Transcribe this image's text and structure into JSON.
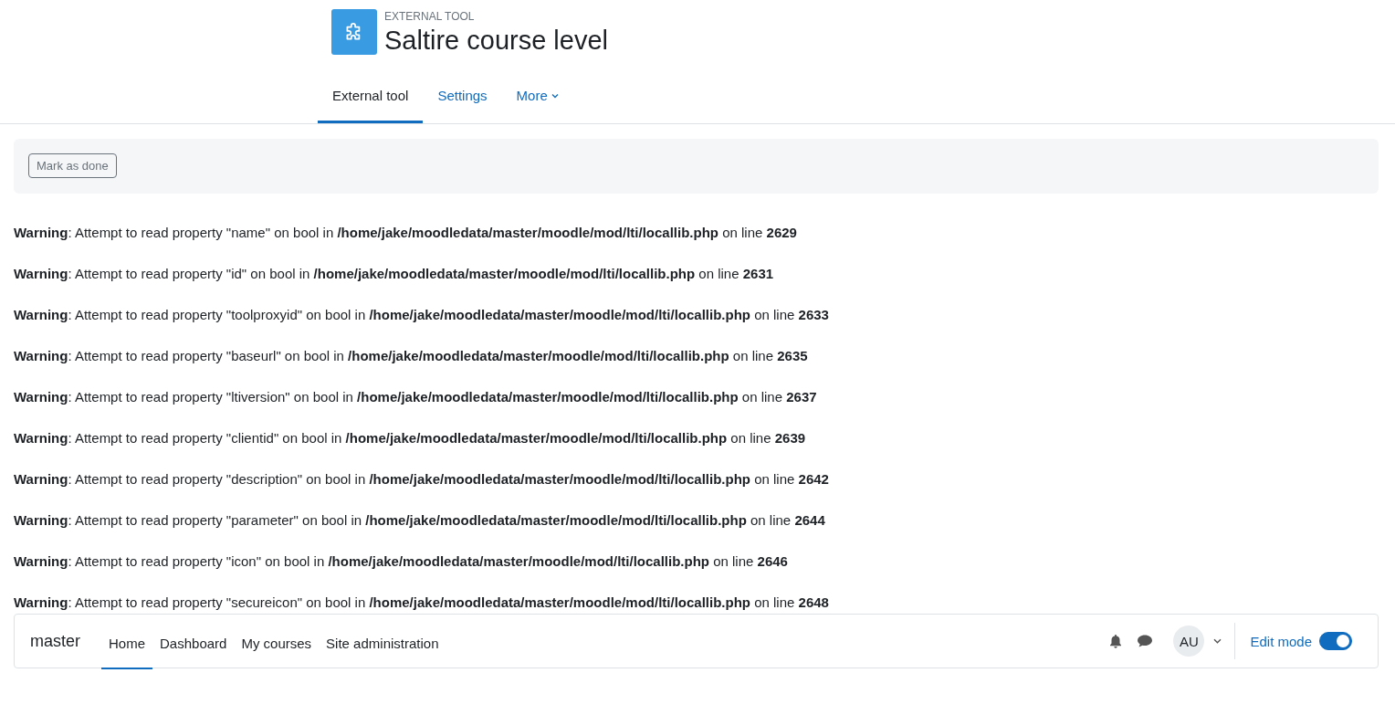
{
  "header": {
    "kind_label": "EXTERNAL TOOL",
    "title": "Saltire course level"
  },
  "tabs": [
    {
      "label": "External tool",
      "selected": true
    },
    {
      "label": "Settings",
      "selected": false
    },
    {
      "label": "More",
      "selected": false,
      "dropdown": true
    }
  ],
  "completion": {
    "button": "Mark as done"
  },
  "warnings": [
    "**Warning**: Attempt to read property \"name\" on bool in **/home/jake/moodledata/master/moodle/mod/lti/locallib.php** on line **2629**",
    "**Warning**: Attempt to read property \"id\" on bool in **/home/jake/moodledata/master/moodle/mod/lti/locallib.php** on line **2631**",
    "**Warning**: Attempt to read property \"toolproxyid\" on bool in **/home/jake/moodledata/master/moodle/mod/lti/locallib.php** on line **2633**",
    "**Warning**: Attempt to read property \"baseurl\" on bool in **/home/jake/moodledata/master/moodle/mod/lti/locallib.php** on line **2635**",
    "**Warning**: Attempt to read property \"ltiversion\" on bool in **/home/jake/moodledata/master/moodle/mod/lti/locallib.php** on line **2637**",
    "**Warning**: Attempt to read property \"clientid\" on bool in **/home/jake/moodledata/master/moodle/mod/lti/locallib.php** on line **2639**",
    "**Warning**: Attempt to read property \"description\" on bool in **/home/jake/moodledata/master/moodle/mod/lti/locallib.php** on line **2642**",
    "**Warning**: Attempt to read property \"parameter\" on bool in **/home/jake/moodledata/master/moodle/mod/lti/locallib.php** on line **2644**",
    "**Warning**: Attempt to read property \"icon\" on bool in **/home/jake/moodledata/master/moodle/mod/lti/locallib.php** on line **2646**",
    "**Warning**: Attempt to read property \"secureicon\" on bool in **/home/jake/moodledata/master/moodle/mod/lti/locallib.php** on line **2648**"
  ],
  "navbar": {
    "site_name": "master",
    "items": [
      {
        "label": "Home",
        "selected": true
      },
      {
        "label": "Dashboard",
        "selected": false
      },
      {
        "label": "My courses",
        "selected": false
      },
      {
        "label": "Site administration",
        "selected": false
      }
    ],
    "avatar": "AU",
    "edit_mode": {
      "label": "Edit mode",
      "on": true
    }
  }
}
